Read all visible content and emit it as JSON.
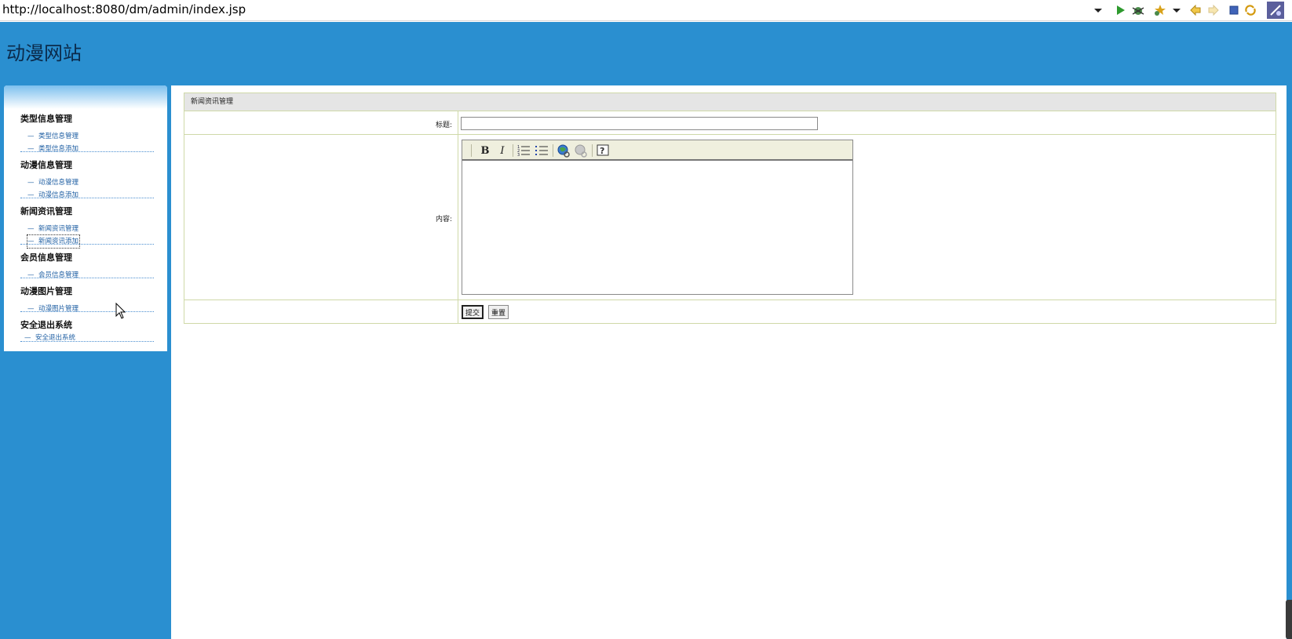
{
  "browser": {
    "url": "http://localhost:8080/dm/admin/index.jsp",
    "toolbar_icons": [
      "dropdown-icon",
      "run-icon",
      "debug-icon",
      "bookmark-star-icon",
      "back-icon",
      "forward-icon",
      "stop-icon",
      "refresh-icon",
      "eclipse-icon"
    ]
  },
  "site": {
    "title": "动漫网站"
  },
  "sidebar": {
    "groups": [
      {
        "heading": "类型信息管理",
        "items": [
          "类型信息管理",
          "类型信息添加"
        ]
      },
      {
        "heading": "动漫信息管理",
        "items": [
          "动漫信息管理",
          "动漫信息添加"
        ]
      },
      {
        "heading": "新闻资讯管理",
        "items": [
          "新闻资讯管理",
          "新闻资讯添加"
        ]
      },
      {
        "heading": "会员信息管理",
        "items": [
          "会员信息管理"
        ]
      },
      {
        "heading": "动漫图片管理",
        "items": [
          "动漫图片管理"
        ]
      },
      {
        "heading": "安全退出系统",
        "items": [
          "安全退出系统"
        ]
      }
    ]
  },
  "main": {
    "panel_title": "新闻资讯管理",
    "form": {
      "title_label": "标题:",
      "title_value": "",
      "content_label": "内容:",
      "editor_tools": [
        "bold-icon",
        "italic-icon",
        "ordered-list-icon",
        "unordered-list-icon",
        "insert-link-icon",
        "remove-link-icon",
        "help-icon"
      ],
      "submit_label": "提交",
      "reset_label": "重置"
    }
  },
  "colors": {
    "header_bg": "#2a8fd0",
    "title_text": "#0b2a4a",
    "link": "#1f5fa3",
    "table_border": "#cfd9a8",
    "panel_title_bg": "#e5e5e5",
    "editor_toolbar_bg": "#efefde"
  }
}
